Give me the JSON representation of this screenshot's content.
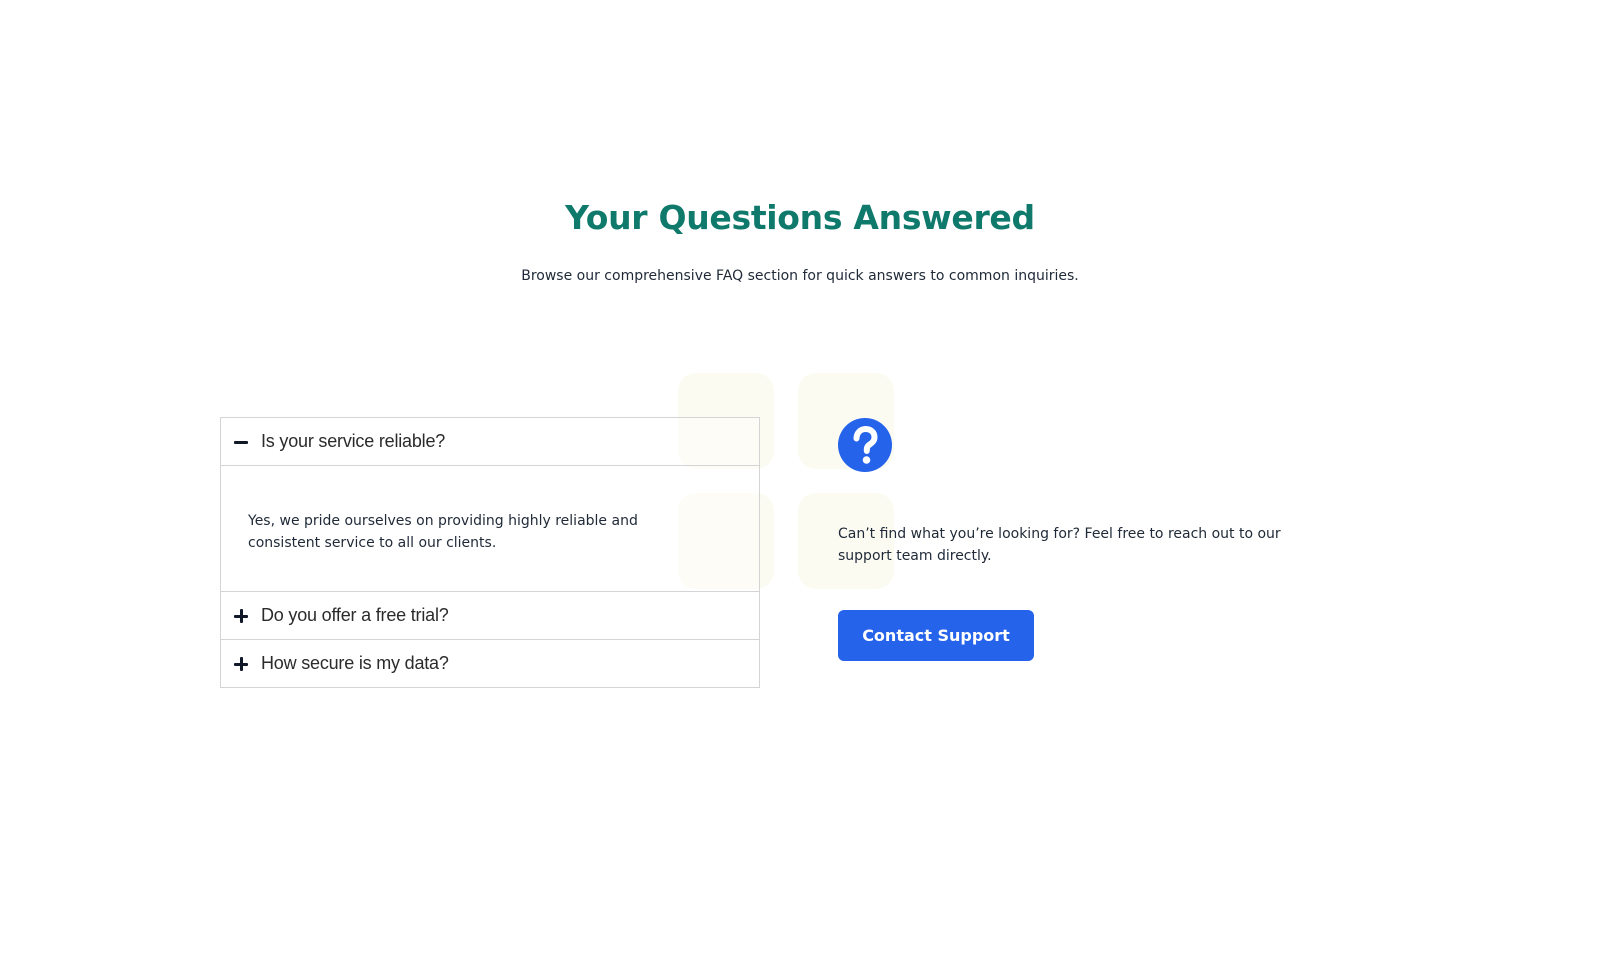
{
  "header": {
    "title": "Your Questions Answered",
    "subtitle": "Browse our comprehensive FAQ section for quick answers to common inquiries."
  },
  "faq": {
    "items": [
      {
        "question": "Is your service reliable?",
        "answer": "Yes, we pride ourselves on providing highly reliable and consistent service to all our clients.",
        "expanded": true,
        "icon": "minus-icon"
      },
      {
        "question": "Do you offer a free trial?",
        "expanded": false,
        "icon": "plus-icon"
      },
      {
        "question": "How secure is my data?",
        "expanded": false,
        "icon": "plus-icon"
      }
    ]
  },
  "support": {
    "icon": "question-circle-icon",
    "text": "Can’t find what you’re looking for? Feel free to reach out to our support team directly.",
    "button_label": "Contact Support"
  },
  "colors": {
    "heading": "#0f7a6c",
    "accent": "#2563eb",
    "border": "#d4d4d4",
    "tile": "#fcfbf2",
    "text": "#1f2937"
  }
}
